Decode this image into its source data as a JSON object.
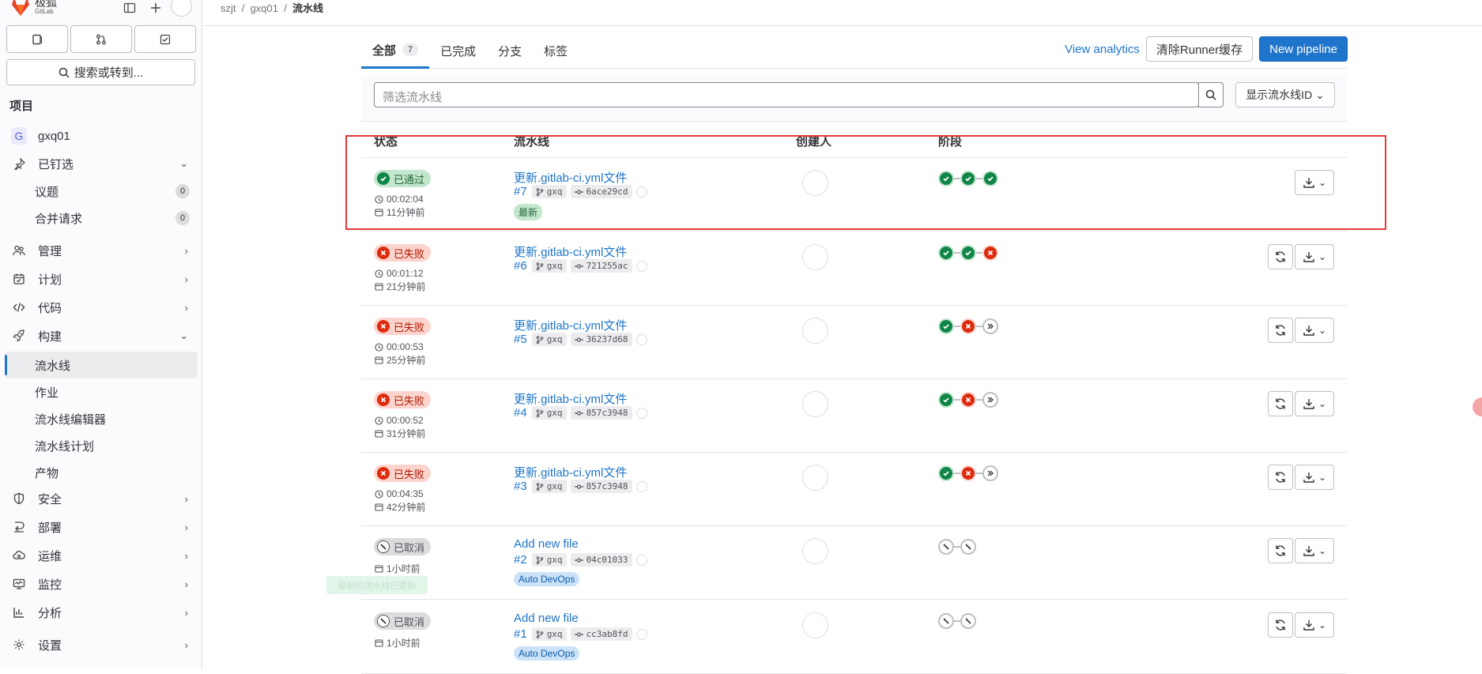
{
  "brand": {
    "name": "极狐",
    "sub": "GitLab"
  },
  "sidebar": {
    "search": "搜索或转到...",
    "section": "项目",
    "project": {
      "initial": "G",
      "name": "gxq01"
    },
    "pinned": "已钉选",
    "pinned_items": [
      {
        "label": "议题",
        "count": "0"
      },
      {
        "label": "合并请求",
        "count": "0"
      }
    ],
    "items": {
      "manage": "管理",
      "plan": "计划",
      "code": "代码",
      "build": "构建",
      "security": "安全",
      "deploy": "部署",
      "operate": "运维",
      "monitor": "监控",
      "analyze": "分析",
      "settings": "设置"
    },
    "build_sub": [
      "流水线",
      "作业",
      "流水线编辑器",
      "流水线计划",
      "产物"
    ]
  },
  "breadcrumb": {
    "group": "szjt",
    "project": "gxq01",
    "current": "流水线"
  },
  "tabs": {
    "all": "全部",
    "all_count": "7",
    "finished": "已完成",
    "branches": "分支",
    "tags": "标签"
  },
  "toolbar": {
    "analytics": "View analytics",
    "clear_cache": "清除Runner缓存",
    "new_pipeline": "New pipeline"
  },
  "filter": {
    "placeholder": "筛选流水线",
    "id_select": "显示流水线ID"
  },
  "columns": {
    "status": "状态",
    "pipeline": "流水线",
    "creator": "创建人",
    "stages": "阶段"
  },
  "pipelines": [
    {
      "status": "已通过",
      "kind": "success",
      "duration": "00:02:04",
      "ago": "11分钟前",
      "title": "更新.gitlab-ci.yml文件",
      "id": "#7",
      "branch": "gxq",
      "sha": "6ace29cd",
      "label": "最新",
      "stages": [
        "success",
        "success",
        "success"
      ]
    },
    {
      "status": "已失败",
      "kind": "failed",
      "duration": "00:01:12",
      "ago": "21分钟前",
      "title": "更新.gitlab-ci.yml文件",
      "id": "#6",
      "branch": "gxq",
      "sha": "721255ac",
      "label": "",
      "stages": [
        "success",
        "success",
        "failed"
      ]
    },
    {
      "status": "已失败",
      "kind": "failed",
      "duration": "00:00:53",
      "ago": "25分钟前",
      "title": "更新.gitlab-ci.yml文件",
      "id": "#5",
      "branch": "gxq",
      "sha": "36237d68",
      "label": "",
      "stages": [
        "success",
        "failed",
        "skipped"
      ]
    },
    {
      "status": "已失败",
      "kind": "failed",
      "duration": "00:00:52",
      "ago": "31分钟前",
      "title": "更新.gitlab-ci.yml文件",
      "id": "#4",
      "branch": "gxq",
      "sha": "857c3948",
      "label": "",
      "stages": [
        "success",
        "failed",
        "skipped"
      ]
    },
    {
      "status": "已失败",
      "kind": "failed",
      "duration": "00:04:35",
      "ago": "42分钟前",
      "title": "更新.gitlab-ci.yml文件",
      "id": "#3",
      "branch": "gxq",
      "sha": "857c3948",
      "label": "",
      "stages": [
        "success",
        "failed",
        "skipped"
      ]
    },
    {
      "status": "已取消",
      "kind": "canceled",
      "duration": "",
      "ago": "1小时前",
      "title": "Add new file",
      "id": "#2",
      "branch": "gxq",
      "sha": "04c01033",
      "label": "Auto DevOps",
      "stages": [
        "canceled",
        "canceled"
      ]
    },
    {
      "status": "已取消",
      "kind": "canceled",
      "duration": "",
      "ago": "1小时前",
      "title": "Add new file",
      "id": "#1",
      "branch": "gxq",
      "sha": "cc3ab8fd",
      "label": "Auto DevOps",
      "stages": [
        "canceled",
        "canceled"
      ]
    }
  ],
  "toast": "最新的流水线已更新",
  "colors": {
    "accent": "#1f75cb",
    "success": "#108548",
    "failed": "#dd2b0e",
    "highlight": "#e53935"
  }
}
